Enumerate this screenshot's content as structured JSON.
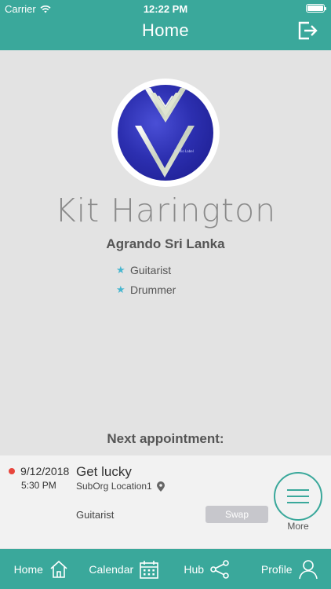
{
  "status_bar": {
    "carrier": "Carrier",
    "time": "12:22 PM"
  },
  "header": {
    "title": "Home"
  },
  "profile": {
    "name": "Kit  Harington",
    "organization": "Agrando Sri Lanka",
    "roles": [
      "Guitarist",
      "Drummer"
    ]
  },
  "next_appointment": {
    "heading": "Next appointment:",
    "date": "9/12/2018",
    "time": "5:30 PM",
    "title": "Get lucky",
    "location": "SubOrg Location1",
    "role": "Guitarist",
    "swap_label": "Swap",
    "more_label": "More"
  },
  "tabbar": {
    "items": [
      {
        "label": "Home",
        "icon": "home-icon"
      },
      {
        "label": "Calendar",
        "icon": "calendar-icon"
      },
      {
        "label": "Hub",
        "icon": "share-icon"
      },
      {
        "label": "Profile",
        "icon": "person-icon"
      }
    ]
  },
  "colors": {
    "accent": "#3aa89b",
    "star": "#47b6cf",
    "status_dot": "#e8453c",
    "background": "#e3e3e3"
  }
}
